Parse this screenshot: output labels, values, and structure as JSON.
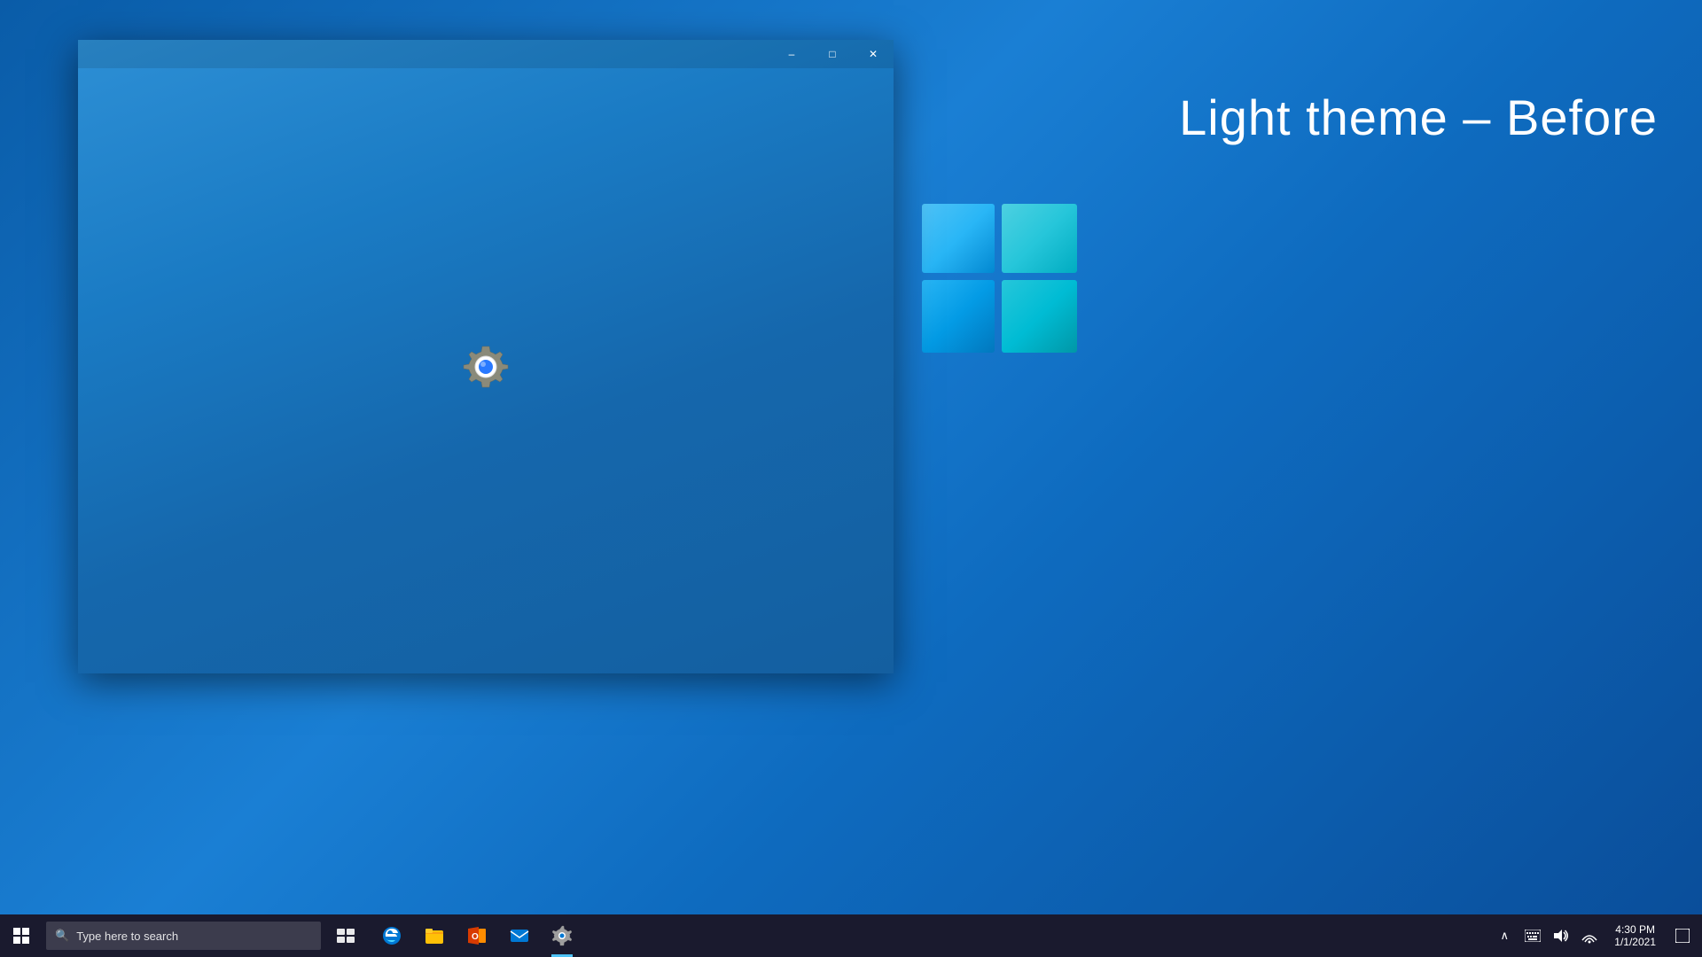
{
  "desktop": {
    "background_color": "#0a5ca8"
  },
  "theme_label": {
    "text": "Light theme – Before"
  },
  "window": {
    "title": "Settings",
    "minimize_label": "–",
    "maximize_label": "□",
    "close_label": "✕"
  },
  "taskbar": {
    "search_placeholder": "Type here to search",
    "apps": [
      {
        "name": "start",
        "icon": "⊞"
      },
      {
        "name": "cortana",
        "icon": "○"
      },
      {
        "name": "task-view",
        "icon": "⧉"
      },
      {
        "name": "edge",
        "icon": "e"
      },
      {
        "name": "file-explorer",
        "icon": "📁"
      },
      {
        "name": "office",
        "icon": "O"
      },
      {
        "name": "mail",
        "icon": "✉"
      },
      {
        "name": "settings",
        "icon": "⚙"
      }
    ],
    "system_icons": [
      "^",
      "⌨",
      "🔊",
      "⚡"
    ],
    "time": "4:30 PM",
    "date": "1/1/2021",
    "notification": "□"
  }
}
